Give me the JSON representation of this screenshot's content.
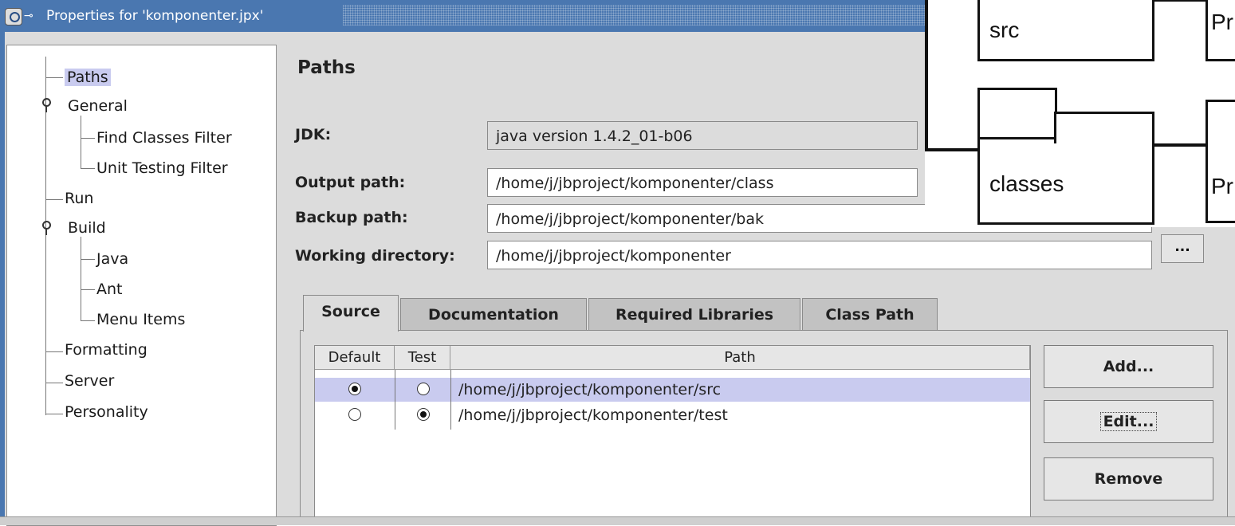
{
  "window": {
    "title": "Properties for 'komponenter.jpx'",
    "title_color": "#4a77b0"
  },
  "tree": {
    "items": [
      {
        "label": "Paths",
        "selected": true
      },
      {
        "label": "General",
        "expanded": true
      },
      {
        "label": "Find Classes Filter"
      },
      {
        "label": "Unit Testing Filter"
      },
      {
        "label": "Run"
      },
      {
        "label": "Build",
        "expanded": true
      },
      {
        "label": "Java"
      },
      {
        "label": "Ant"
      },
      {
        "label": "Menu Items"
      },
      {
        "label": "Formatting"
      },
      {
        "label": "Server"
      },
      {
        "label": "Personality"
      }
    ]
  },
  "paths": {
    "heading": "Paths",
    "jdk_label": "JDK:",
    "jdk_value": "java version 1.4.2_01-b06",
    "output_label": "Output path:",
    "output_value": "/home/j/jbproject/komponenter/class",
    "backup_label": "Backup path:",
    "backup_value": "/home/j/jbproject/komponenter/bak",
    "working_label": "Working directory:",
    "working_value": "/home/j/jbproject/komponenter",
    "browse_label": "..."
  },
  "tabs": [
    {
      "label": "Source",
      "active": true
    },
    {
      "label": "Documentation"
    },
    {
      "label": "Required Libraries"
    },
    {
      "label": "Class Path"
    }
  ],
  "source_table": {
    "headers": [
      "Default",
      "Test",
      "Path"
    ],
    "rows": [
      {
        "default": true,
        "test": false,
        "path": "/home/j/jbproject/komponenter/src",
        "selected": true
      },
      {
        "default": false,
        "test": true,
        "path": "/home/j/jbproject/komponenter/test",
        "selected": false
      }
    ]
  },
  "buttons": {
    "add": "Add...",
    "edit": "Edit...",
    "remove": "Remove"
  },
  "diagram": {
    "box_src": "src",
    "box_classes": "classes",
    "right_top": "Pr",
    "right_bottom": "Pr"
  }
}
